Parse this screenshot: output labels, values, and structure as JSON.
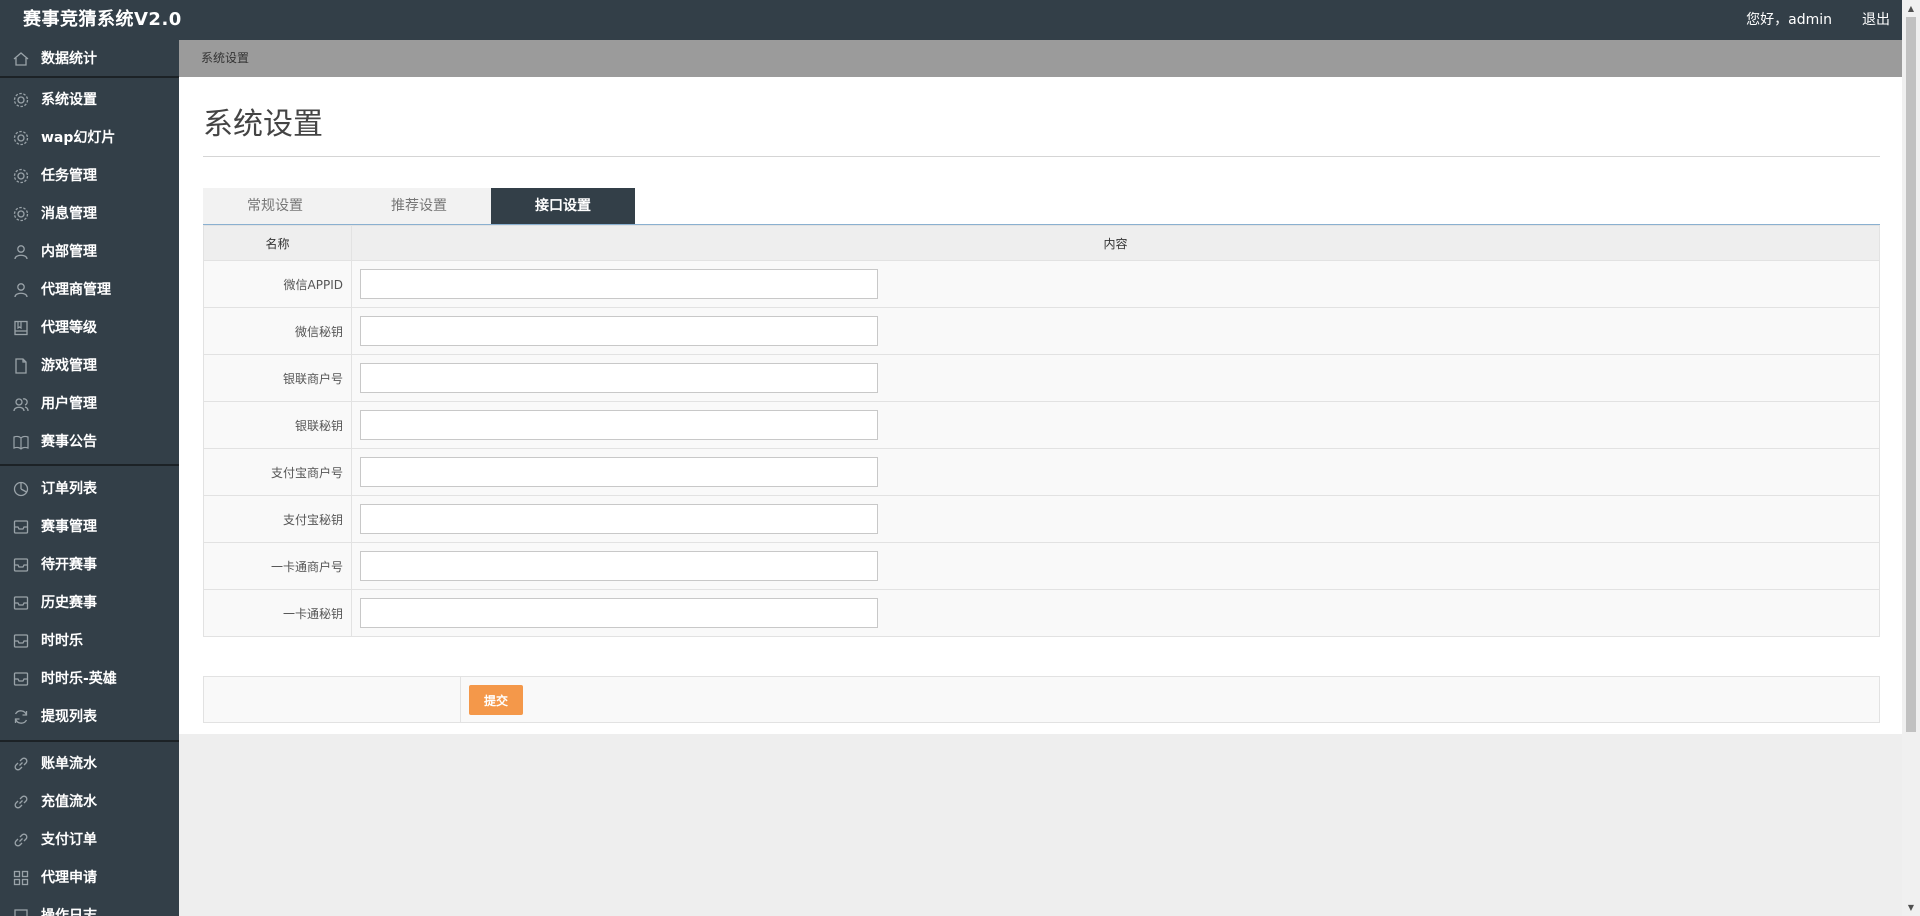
{
  "header": {
    "brand": "赛事竞猜系统V2.0",
    "greeting": "您好，admin",
    "logout": "退出"
  },
  "sidebar": {
    "items": [
      {
        "label": "数据统计",
        "icon": "home-icon"
      },
      {
        "label": "系统设置",
        "icon": "gear-icon"
      },
      {
        "label": "wap幻灯片",
        "icon": "gear-icon"
      },
      {
        "label": "任务管理",
        "icon": "gear-icon"
      },
      {
        "label": "消息管理",
        "icon": "gear-icon"
      },
      {
        "label": "内部管理",
        "icon": "user-icon"
      },
      {
        "label": "代理商管理",
        "icon": "user-icon"
      },
      {
        "label": "代理等级",
        "icon": "book-icon"
      },
      {
        "label": "游戏管理",
        "icon": "document-icon"
      },
      {
        "label": "用户管理",
        "icon": "users-icon"
      },
      {
        "label": "赛事公告",
        "icon": "open-book-icon"
      },
      {
        "label": "订单列表",
        "icon": "pie-icon"
      },
      {
        "label": "赛事管理",
        "icon": "inbox-icon"
      },
      {
        "label": "待开赛事",
        "icon": "inbox-icon"
      },
      {
        "label": "历史赛事",
        "icon": "inbox-icon"
      },
      {
        "label": "时时乐",
        "icon": "inbox-icon"
      },
      {
        "label": "时时乐-英雄",
        "icon": "inbox-icon"
      },
      {
        "label": "提现列表",
        "icon": "refresh-icon"
      },
      {
        "label": "账单流水",
        "icon": "link-icon"
      },
      {
        "label": "充值流水",
        "icon": "link-icon"
      },
      {
        "label": "支付订单",
        "icon": "link-icon"
      },
      {
        "label": "代理申请",
        "icon": "grid-icon"
      },
      {
        "label": "操作日志",
        "icon": "square-icon"
      }
    ]
  },
  "breadcrumb": "系统设置",
  "page_title": "系统设置",
  "tabs": [
    {
      "label": "常规设置",
      "active": false
    },
    {
      "label": "推荐设置",
      "active": false
    },
    {
      "label": "接口设置",
      "active": true
    }
  ],
  "table": {
    "headers": [
      "名称",
      "内容"
    ],
    "rows": [
      {
        "label": "微信APPID",
        "value": ""
      },
      {
        "label": "微信秘钥",
        "value": ""
      },
      {
        "label": "银联商户号",
        "value": ""
      },
      {
        "label": "银联秘钥",
        "value": ""
      },
      {
        "label": "支付宝商户号",
        "value": ""
      },
      {
        "label": "支付宝秘钥",
        "value": ""
      },
      {
        "label": "一卡通商户号",
        "value": ""
      },
      {
        "label": "一卡通秘钥",
        "value": ""
      }
    ]
  },
  "submit_label": "提交",
  "colors": {
    "sidebar_bg": "#333f48",
    "breadcrumb_bg": "#9b9b9b",
    "submit_bg": "#f4984a"
  }
}
